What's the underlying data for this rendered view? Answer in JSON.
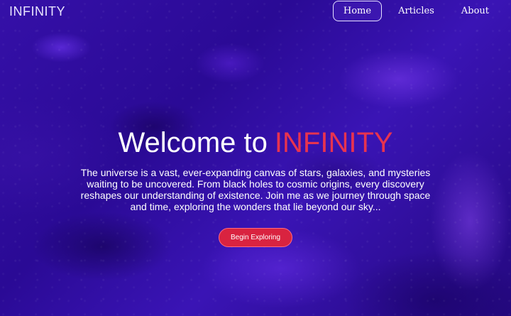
{
  "nav": {
    "brand": "INFINITY",
    "links": [
      {
        "label": "Home",
        "active": true
      },
      {
        "label": "Articles",
        "active": false
      },
      {
        "label": "About",
        "active": false
      }
    ]
  },
  "hero": {
    "title_prefix": "Welcome to",
    "title_accent": "INFINITY",
    "description": "The universe is a vast, ever-expanding canvas of stars, galaxies, and mysteries waiting to be uncovered. From black holes to cosmic origins, every discovery reshapes our understanding of existence. Join me as we journey through space and time, exploring the wonders that lie beyond our sky...",
    "cta_label": "Begin Exploring"
  },
  "colors": {
    "background": "#2a0c8a",
    "accent": "#e8334f",
    "button": "#d92340"
  }
}
